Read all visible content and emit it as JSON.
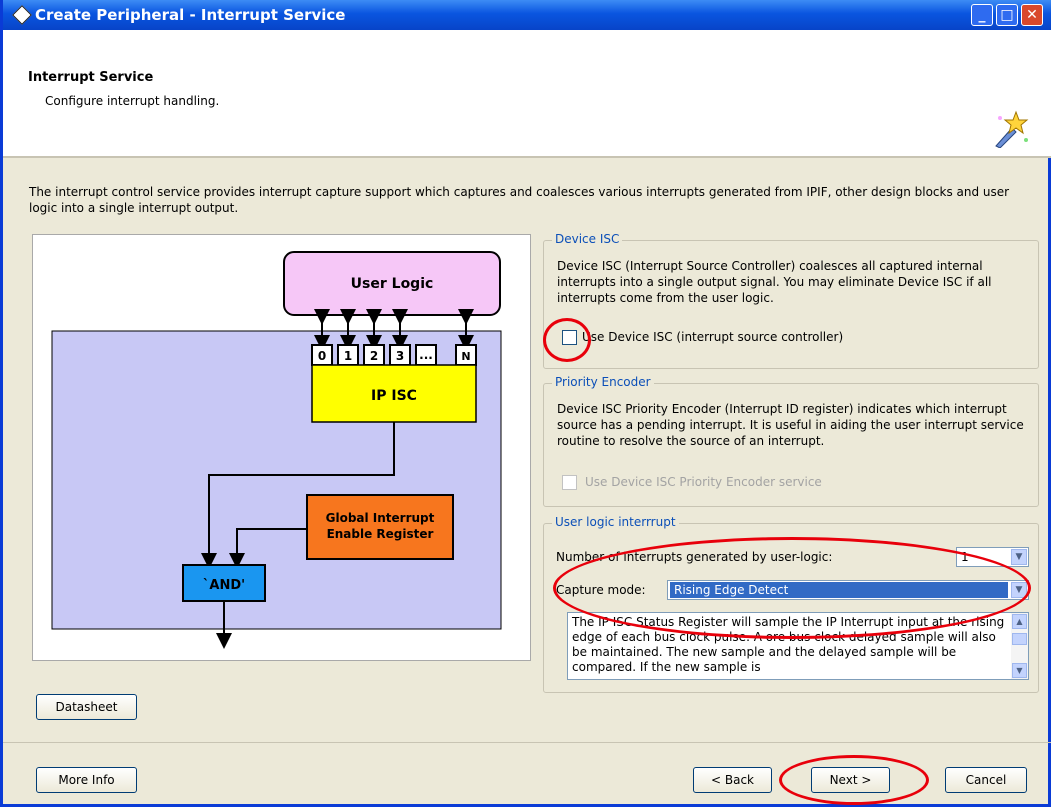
{
  "window": {
    "title": "Create Peripheral - Interrupt Service",
    "minimize_glyph": "_",
    "maximize_glyph": "□",
    "close_glyph": "✕"
  },
  "header": {
    "title": "Interrupt Service",
    "subtitle": "Configure interrupt handling."
  },
  "description": "The interrupt control service provides interrupt capture support which captures and coalesces various interrupts generated from IPIF, other design blocks and user logic into a single interrupt output.",
  "diagram": {
    "user_logic": "User Logic",
    "ports": [
      "0",
      "1",
      "2",
      "3",
      "...",
      "N"
    ],
    "ip_isc": "IP ISC",
    "global_interrupt_line1": "Global Interrupt",
    "global_interrupt_line2": "Enable Register",
    "and_gate": "`AND'"
  },
  "device_isc": {
    "legend": "Device ISC",
    "text": "Device ISC (Interrupt Source Controller) coalesces all captured internal interrupts into a single output signal. You may eliminate Device ISC if all interrupts come from the user logic.",
    "checkbox_label": "Use Device ISC (interrupt source controller)",
    "checked": false
  },
  "priority_encoder": {
    "legend": "Priority Encoder",
    "text": "Device ISC Priority Encoder (Interrupt ID register) indicates which interrupt source has a pending interrupt. It is useful in aiding the user interrupt service routine to resolve the source of an interrupt.",
    "checkbox_label": "Use Device ISC Priority Encoder service",
    "checked": false,
    "enabled": false
  },
  "user_logic_interrupt": {
    "legend": "User logic interrrupt",
    "num_label": "Number of interrupts generated by user-logic:",
    "num_value": "1",
    "capture_label": "Capture mode:",
    "capture_value": "Rising Edge Detect",
    "help_text": "The IP ISC Status Register will sample the IP Interrupt input at the rising edge of each bus clock pulse. A ore bus clock delayed sample will also be maintained. The new sample and the delayed sample will be compared. If the new sample is"
  },
  "buttons": {
    "datasheet": "Datasheet",
    "more_info": "More Info",
    "back": "< Back",
    "next": "Next >",
    "cancel": "Cancel"
  },
  "colors": {
    "user_logic_fill": "#f6c7f7",
    "ip_isc_fill": "#ffff00",
    "global_interrupt_fill": "#f7761e",
    "and_fill": "#1a96f0",
    "background_block_fill": "#c8c8f5",
    "annotation_red": "#e8000b"
  },
  "icons": {
    "app": "diamond-app-icon",
    "wizard": "magic-wand-icon"
  }
}
